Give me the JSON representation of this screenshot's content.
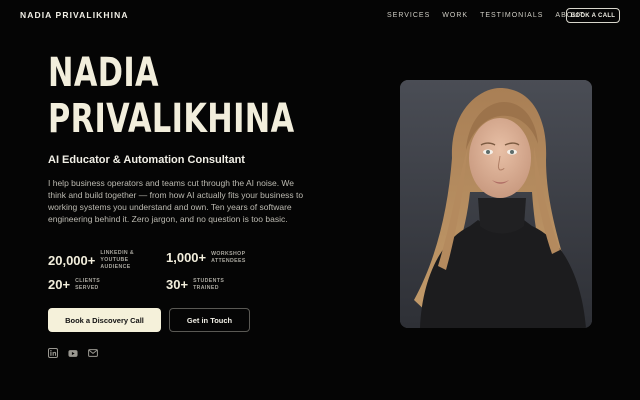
{
  "nav": {
    "logo": "NADIA PRIVALIKHINA",
    "links": [
      "SERVICES",
      "WORK",
      "TESTIMONIALS",
      "ABOUT"
    ],
    "cta": "BOOK A CALL"
  },
  "hero": {
    "name_line1": "NADIA",
    "name_line2": "PRIVALIKHINA",
    "subtitle": "AI Educator & Automation Consultant",
    "bio": "I help business operators and teams cut through the AI noise. We think and build together — from how AI actually fits your business to working systems you understand and own. Ten years of software engineering behind it. Zero jargon, and no question is too basic.",
    "stats": [
      {
        "value": "20,000+",
        "label": "LINKEDIN & YOUTUBE AUDIENCE"
      },
      {
        "value": "1,000+",
        "label": "WORKSHOP ATTENDEES"
      },
      {
        "value": "20+",
        "label": "CLIENTS SERVED"
      },
      {
        "value": "30+",
        "label": "STUDENTS TRAINED"
      }
    ],
    "primary_cta": "Book a Discovery Call",
    "secondary_cta": "Get in Touch",
    "socials": [
      "linkedin-icon",
      "youtube-icon",
      "mail-icon"
    ]
  },
  "colors": {
    "background": "#050505",
    "accent": "#f5f1da",
    "text": "#ecebe4"
  }
}
